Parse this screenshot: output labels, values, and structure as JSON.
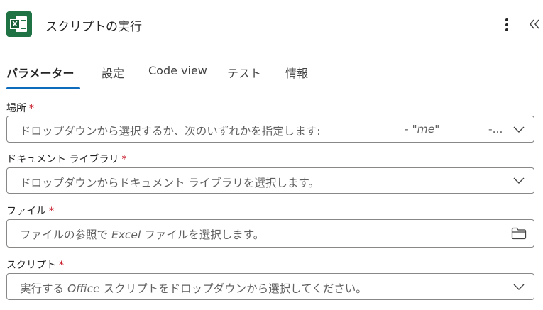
{
  "header": {
    "title": "スクリプトの実行",
    "app_icon_letter": "X",
    "brand_color": "#1f7244"
  },
  "tabs": [
    {
      "label": "パラメーター",
      "active": true
    },
    {
      "label": "設定",
      "active": false
    },
    {
      "label": "Code view",
      "active": false
    },
    {
      "label": "テスト",
      "active": false
    },
    {
      "label": "情報",
      "active": false
    }
  ],
  "accent_color": "#0f6cbd",
  "fields": {
    "location": {
      "label": "場所",
      "required_mark": "*",
      "placeholder": "ドロップダウンから選択するか、次のいずれかを指定します:",
      "placeholder_mid": "- \"me\"",
      "placeholder_end": "-...",
      "icon": "chevron-down-icon"
    },
    "document_library": {
      "label": "ドキュメント ライブラリ",
      "required_mark": "*",
      "placeholder": "ドロップダウンからドキュメント ライブラリを選択します。",
      "icon": "chevron-down-icon"
    },
    "file": {
      "label": "ファイル",
      "required_mark": "*",
      "placeholder_pre": "ファイルの参照で ",
      "placeholder_em": "Excel",
      "placeholder_post": " ファイルを選択します。",
      "icon": "folder-icon"
    },
    "script": {
      "label": "スクリプト",
      "required_mark": "*",
      "placeholder_pre": "実行する ",
      "placeholder_em": "Office",
      "placeholder_post": " スクリプトをドロップダウンから選択してください。",
      "icon": "chevron-down-icon"
    }
  }
}
